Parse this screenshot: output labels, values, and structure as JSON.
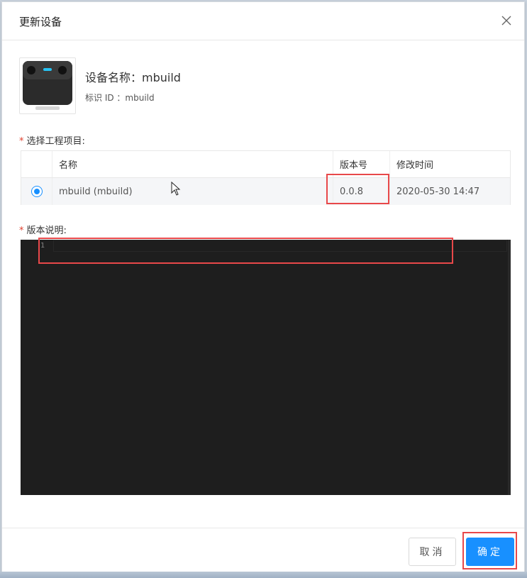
{
  "dialog": {
    "title": "更新设备",
    "close_icon": "close-icon"
  },
  "device": {
    "name_line": "设备名称：mbuild",
    "id_line": "标识 ID ：mbuild",
    "thumbnail_icon": "device-thumbnail"
  },
  "project": {
    "label": "选择工程项目:",
    "required_mark": "*",
    "columns": [
      "名称",
      "版本号",
      "修改时间"
    ],
    "rows": [
      {
        "selected": true,
        "name": "mbuild (mbuild)",
        "version": "0.0.8",
        "modified": "2020-05-30 14:47"
      }
    ]
  },
  "version_notes": {
    "label": "版本说明:",
    "required_mark": "*",
    "line_number": "1",
    "editor_background": "#1e1e1e"
  },
  "footer": {
    "cancel_label": "取消",
    "ok_label": "确定"
  },
  "colors": {
    "primary": "#1890ff",
    "required": "#e0412f",
    "highlight": "#e8484a"
  }
}
